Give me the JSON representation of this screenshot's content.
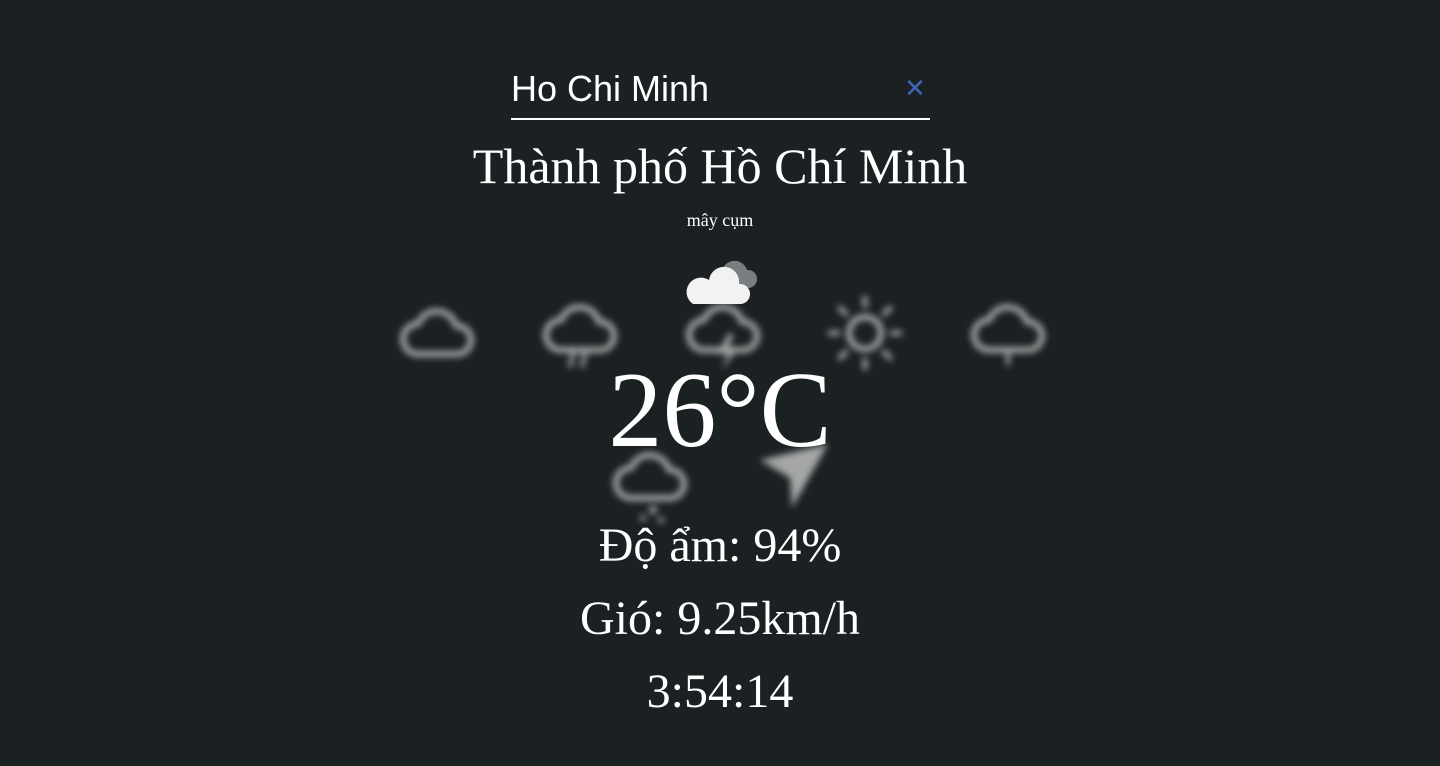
{
  "search": {
    "value": "Ho Chi Minh",
    "clear_icon": "close-icon",
    "clear_color": "#3f63b8"
  },
  "weather": {
    "city": "Thành phố Hồ Chí Minh",
    "description": "mây cụm",
    "icon": "broken-clouds-icon",
    "temperature": "26°C",
    "humidity": "Độ ẩm: 94%",
    "wind": "Gió: 9.25km/h",
    "time": "3:54:14"
  },
  "background_icons": [
    "cloud-icon",
    "cloud-rain-icon",
    "cloud-lightning-icon",
    "sun-icon",
    "cloud-drizzle-icon",
    "cloud-snow-icon",
    "navigation-arrow-icon"
  ],
  "colors": {
    "background": "#1b2022",
    "text": "#ffffff"
  }
}
